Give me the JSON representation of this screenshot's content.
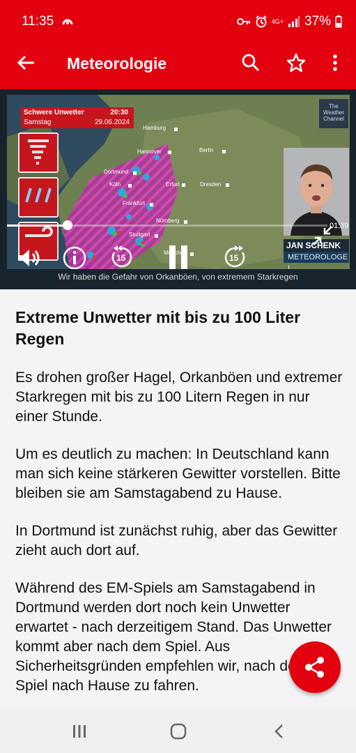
{
  "status": {
    "time": "11:35",
    "battery": "37%",
    "network": "4G+"
  },
  "appbar": {
    "title": "Meteorologie",
    "back_icon": "arrow-left-icon",
    "search_icon": "search-icon",
    "favorite_icon": "star-outline-icon",
    "menu_icon": "more-vert-icon"
  },
  "video": {
    "warning_title": "Schwere Unwetter",
    "warning_time": "20:30",
    "warning_day": "Samstag",
    "warning_date": "29.06.2024",
    "logo_line1": "The",
    "logo_line2": "Weather",
    "logo_line3": "Channel",
    "cities": {
      "hamburg": "Hamburg",
      "hannover": "Hannover",
      "berlin": "Berlin",
      "dortmund": "Dortmund",
      "koeln": "Köln",
      "erfurt": "Erfurt",
      "dresden": "Dresden",
      "frankfurt": "Frankfurt",
      "nuernberg": "Nürnberg",
      "stuttgart": "Stuttgart",
      "muenchen": "München"
    },
    "presenter_name": "JAN SCHENK",
    "presenter_role": "METEOROLOGE I",
    "elapsed": "01:39",
    "progress": 0.19,
    "rewind_seconds": "15",
    "forward_seconds": "15",
    "caption": "Wir haben die Gefahr von Orkanböen, von extremem Starkregen",
    "accent": "#e3000f"
  },
  "article": {
    "headline": "Extreme Unwetter mit bis zu 100 Liter Regen",
    "paragraphs": [
      "Es drohen großer Hagel, Orkanböen und extremer Starkregen mit bis zu 100 Litern Regen in nur einer Stunde.",
      "Um es deutlich zu machen: In Deutschland kann man sich keine stärkeren Gewitter vorstellen. Bitte bleiben sie am Samstagabend zu Hause.",
      "In Dortmund ist zunächst ruhig, aber das Gewitter zieht auch dort auf.",
      "Während des EM-Spiels am Samstagabend in Dortmund werden dort noch kein Unwetter erwartet - nach derzeitigem Stand. Das Unwetter kommt aber nach dem Spiel. Aus Sicherheitsgründen empfehlen wir, nach dem Spiel nach Hause zu fahren."
    ]
  },
  "fab": {
    "icon": "share-icon"
  },
  "navbar": {
    "recents_icon": "recents-icon",
    "home_icon": "home-icon",
    "back_icon": "back-chevron-icon"
  }
}
